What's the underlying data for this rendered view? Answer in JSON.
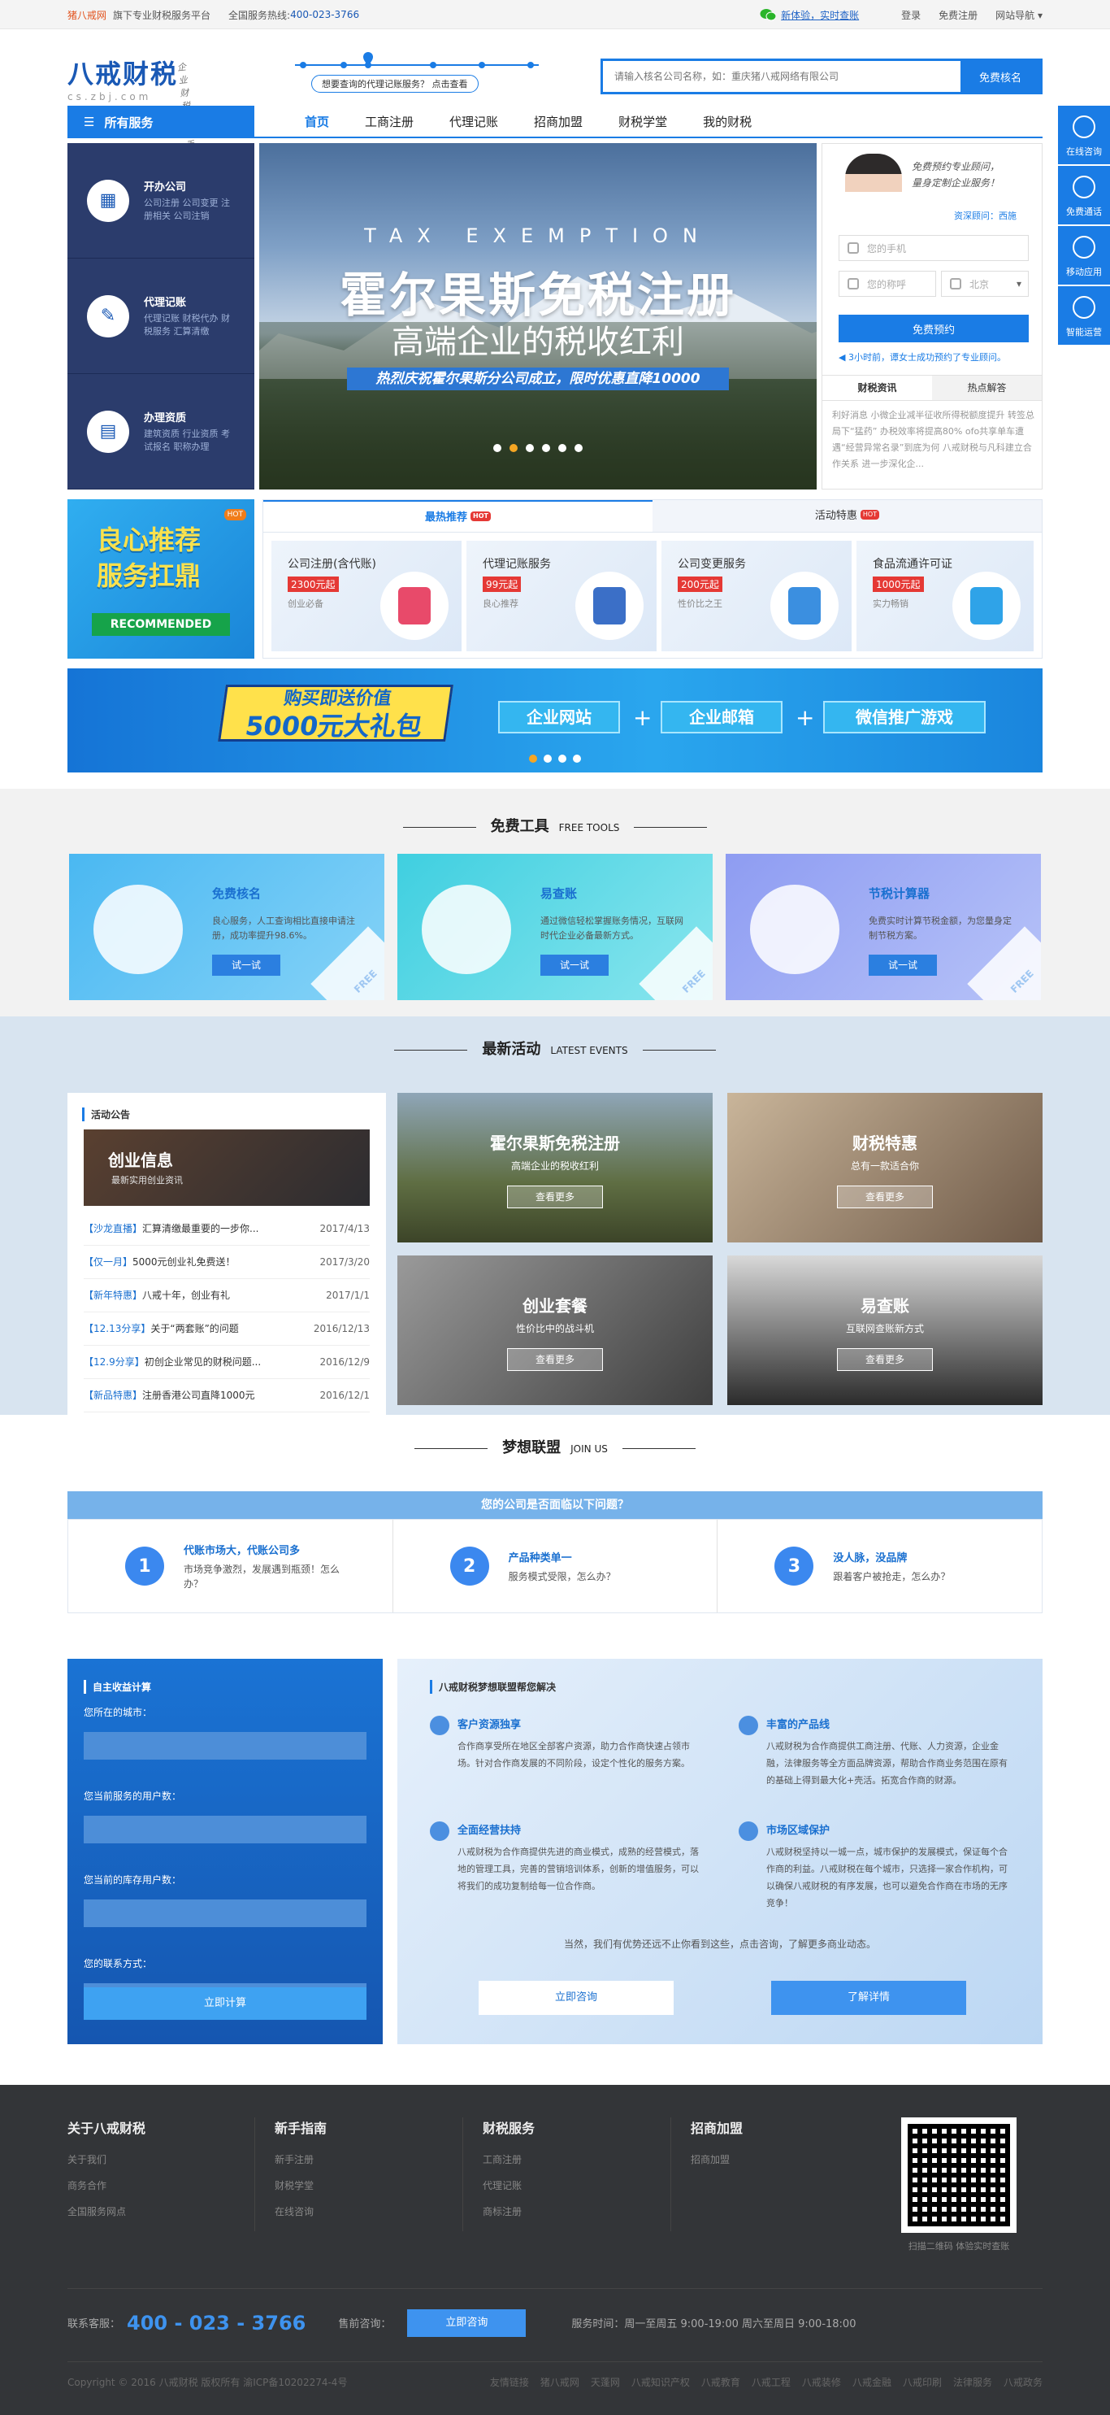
{
  "topbar": {
    "brand": "猪八戒网",
    "sub": "旗下专业财税服务平台",
    "hotline_label": "全国服务热线:",
    "hotline": "400-023-3766",
    "wechat": "新体验，实时查账",
    "login": "登录",
    "register": "免费注册",
    "site_nav": "网站导航"
  },
  "header": {
    "logo_cn": "八戒财税",
    "logo_en": "cs.zbj.com",
    "slogan": "企业财税好帮手",
    "progress_text": "想要查询的代理记账服务？ 点击查看",
    "search_placeholder": "请输入核名公司名称，如：重庆猪八戒网络有限公司",
    "search_button": "免费核名"
  },
  "nav": {
    "all": "所有服务",
    "items": [
      "首页",
      "工商注册",
      "代理记账",
      "招商加盟",
      "财税学堂",
      "我的财税"
    ]
  },
  "float": [
    "在线咨询",
    "免费通话",
    "移动应用",
    "智能运营"
  ],
  "categories": [
    {
      "title": "开办公司",
      "sub": "公司注册 公司变更 注册相关 公司注销",
      "icon": "building-icon"
    },
    {
      "title": "代理记账",
      "sub": "代理记账 财税代办 财税服务 汇算清缴",
      "icon": "ledger-icon"
    },
    {
      "title": "办理资质",
      "sub": "建筑资质 行业资质 考试报名 职称办理",
      "icon": "certificate-icon"
    }
  ],
  "banner": {
    "en": "TAX EXEMPTION",
    "title": "霍尔果斯免税注册",
    "subtitle": "高端企业的税收红利",
    "tagline": "热烈庆祝霍尔果斯分公司成立，限时优惠直降10000"
  },
  "consult": {
    "quote": "免费预约专业顾问，\n量身定制企业服务！",
    "advisor": "资深顾问：西施",
    "phone_placeholder": "您的手机",
    "name_placeholder": "您的称呼",
    "city": "北京",
    "button": "免费预约",
    "note": "3小时前，谭女士成功预约了专业顾问。",
    "tabs": [
      "财税资讯",
      "热点解答"
    ],
    "news": "利好消息 小微企业减半征收所得税额度提升 转签总局下“猛药” 办税效率将提高80% ofo共享单车遭遇“经营异常名录”到底为何 八戒财税与凡科建立合作关系 进一步深化企..."
  },
  "recommend": {
    "big_title": "良心推荐\n服务扛鼎",
    "big_en": "RECOMMENDED",
    "big_hot": "HOT",
    "tabs": [
      "最热推荐",
      "活动特惠"
    ],
    "tab_badge": "HOT",
    "items": [
      {
        "title": "公司注册(含代账)",
        "price": "2300元起",
        "sub": "创业必备",
        "color": "#e84a6a"
      },
      {
        "title": "代理记账服务",
        "price": "99元起",
        "sub": "良心推荐",
        "color": "#3b6fc7"
      },
      {
        "title": "公司变更服务",
        "price": "200元起",
        "sub": "性价比之王",
        "color": "#3b8fe0"
      },
      {
        "title": "食品流通许可证",
        "price": "1000元起",
        "sub": "实力畅销",
        "color": "#2fa3e8"
      }
    ]
  },
  "promo": {
    "l1": "购买即送价值",
    "l2": "5000元大礼包",
    "pills": [
      "企业网站",
      "企业邮箱",
      "微信推广游戏"
    ],
    "plus": "+"
  },
  "tools": {
    "title": "免费工具",
    "en": "FREE TOOLS",
    "items": [
      {
        "title": "免费核名",
        "desc": "良心服务，人工查询相比直接申请注册，成功率提升98.6%。",
        "btn": "试一试"
      },
      {
        "title": "易查账",
        "desc": "通过微信轻松掌握账务情况，互联网时代企业必备最新方式。",
        "btn": "试一试"
      },
      {
        "title": "节税计算器",
        "desc": "免费实时计算节税金额，为您量身定制节税方案。",
        "btn": "试一试"
      }
    ],
    "free": "FREE"
  },
  "events": {
    "title": "最新活动",
    "en": "LATEST EVENTS",
    "list_title": "活动公告",
    "img_title": "创业信息",
    "img_sub": "最新实用创业资讯",
    "items": [
      {
        "tag": "【沙龙直播】",
        "text": "汇算清缴最重要的一步你...",
        "date": "2017/4/13"
      },
      {
        "tag": "【仅一月】",
        "text": "5000元创业礼免费送！",
        "date": "2017/3/20"
      },
      {
        "tag": "【新年特惠】",
        "text": "八戒十年，创业有礼",
        "date": "2017/1/1"
      },
      {
        "tag": "【12.13分享】",
        "text": "关于“两套账”的问题",
        "date": "2016/12/13"
      },
      {
        "tag": "【12.9分享】",
        "text": "初创企业常见的财税问题...",
        "date": "2016/12/9"
      },
      {
        "tag": "【新品特惠】",
        "text": "注册香港公司直降1000元",
        "date": "2016/12/1"
      }
    ],
    "cards": [
      {
        "title": "霍尔果斯免税注册",
        "sub": "高端企业的税收红利",
        "btn": "查看更多"
      },
      {
        "title": "财税特惠",
        "sub": "总有一款适合你",
        "btn": "查看更多"
      },
      {
        "title": "创业套餐",
        "sub": "性价比中的战斗机",
        "btn": "查看更多"
      },
      {
        "title": "易查账",
        "sub": "互联网查账新方式",
        "btn": "查看更多"
      }
    ]
  },
  "join": {
    "title": "梦想联盟",
    "en": "JOIN US",
    "bar": "您的公司是否面临以下问题？",
    "items": [
      {
        "n": "1",
        "title": "代账市场大，代账公司多",
        "sub": "市场竞争激烈，发展遇到瓶颈！怎么办？"
      },
      {
        "n": "2",
        "title": "产品种类单一",
        "sub": "服务模式受限，怎么办？"
      },
      {
        "n": "3",
        "title": "没人脉，没品牌",
        "sub": "跟着客户被抢走，怎么办？"
      }
    ]
  },
  "calc": {
    "title": "自主收益计算",
    "labels": [
      "您所在的城市：",
      "您当前服务的用户数：",
      "您当前的库存用户数：",
      "您的联系方式："
    ],
    "button": "立即计算"
  },
  "help": {
    "title": "八戒财税梦想联盟帮您解决",
    "items": [
      {
        "title": "客户资源独享",
        "desc": "合作商享受所在地区全部客户资源，助力合作商快速占领市场。针对合作商发展的不同阶段，设定个性化的服务方案。"
      },
      {
        "title": "丰富的产品线",
        "desc": "八戒财税为合作商提供工商注册、代账、人力资源，企业金融，法律服务等全方面品牌资源，帮助合作商业务范围在原有的基础上得到最大化+壳活。拓宽合作商的财源。"
      },
      {
        "title": "全面经营扶持",
        "desc": "八戒财税为合作商提供先进的商业模式，成熟的经营模式，落地的管理工具，完善的营销培训体系，创新的增值服务，可以将我们的成功复制给每一位合作商。"
      },
      {
        "title": "市场区域保护",
        "desc": "八戒财税坚持以一城一点，城市保护的发展模式，保证每个合作商的利益。八戒财税在每个城市，只选择一家合作机构，可以确保八戒财税的有序发展，也可以避免合作商在市场的无序竞争！"
      }
    ],
    "foot": "当然，我们有优势还远不止你看到这些，点击咨询，了解更多商业动态。",
    "btn1": "立即咨询",
    "btn2": "了解详情"
  },
  "footer": {
    "cols": [
      {
        "title": "关于八戒财税",
        "items": [
          "关于我们",
          "商务合作",
          "全国服务网点"
        ]
      },
      {
        "title": "新手指南",
        "items": [
          "新手注册",
          "财税学堂",
          "在线咨询"
        ]
      },
      {
        "title": "财税服务",
        "items": [
          "工商注册",
          "代理记账",
          "商标注册"
        ]
      },
      {
        "title": "招商加盟",
        "items": [
          "招商加盟"
        ]
      }
    ],
    "qr_label": "扫描二维码 体验实时查账",
    "service_label": "联系客服：",
    "tel": "400 - 023 - 3766",
    "presale": "售前咨询：",
    "consult_btn": "立即咨询",
    "hours": "服务时间：周一至周五 9:00-19:00 周六至周日 9:00-18:00",
    "copyright": "Copyright © 2016 八戒财税 版权所有 渝ICP备10202274-4号",
    "links": [
      "友情链接",
      "猪八戒网",
      "天蓬网",
      "八戒知识产权",
      "八戒教育",
      "八戒工程",
      "八戒装修",
      "八戒金融",
      "八戒印刷",
      "法律服务",
      "八戒政务"
    ]
  }
}
